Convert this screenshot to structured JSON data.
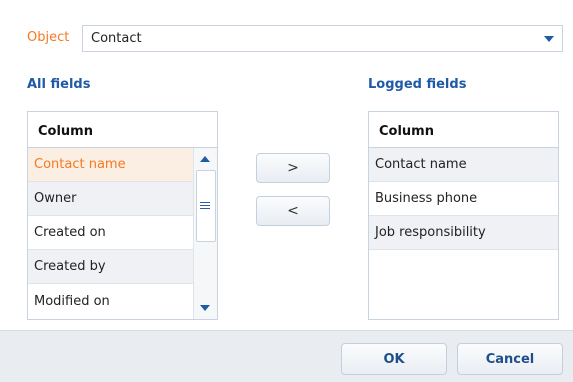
{
  "object": {
    "label": "Object",
    "value": "Contact",
    "icon": "chevron-down-icon"
  },
  "all_fields": {
    "title": "All fields",
    "column_header": "Column",
    "rows": [
      "Contact name",
      "Owner",
      "Created on",
      "Created by",
      "Modified on"
    ],
    "selected_row": "Contact name"
  },
  "logged_fields": {
    "title": "Logged fields",
    "column_header": "Column",
    "rows": [
      "Contact name",
      "Business phone",
      "Job responsibility"
    ]
  },
  "transfer": {
    "add_label": ">",
    "remove_label": "<"
  },
  "footer": {
    "ok_label": "OK",
    "cancel_label": "Cancel"
  },
  "colors": {
    "accent": "#f47a20",
    "title_blue": "#1f5aa6",
    "button_text": "#1f4f8a",
    "selected_row_bg": "#fbeee3"
  }
}
